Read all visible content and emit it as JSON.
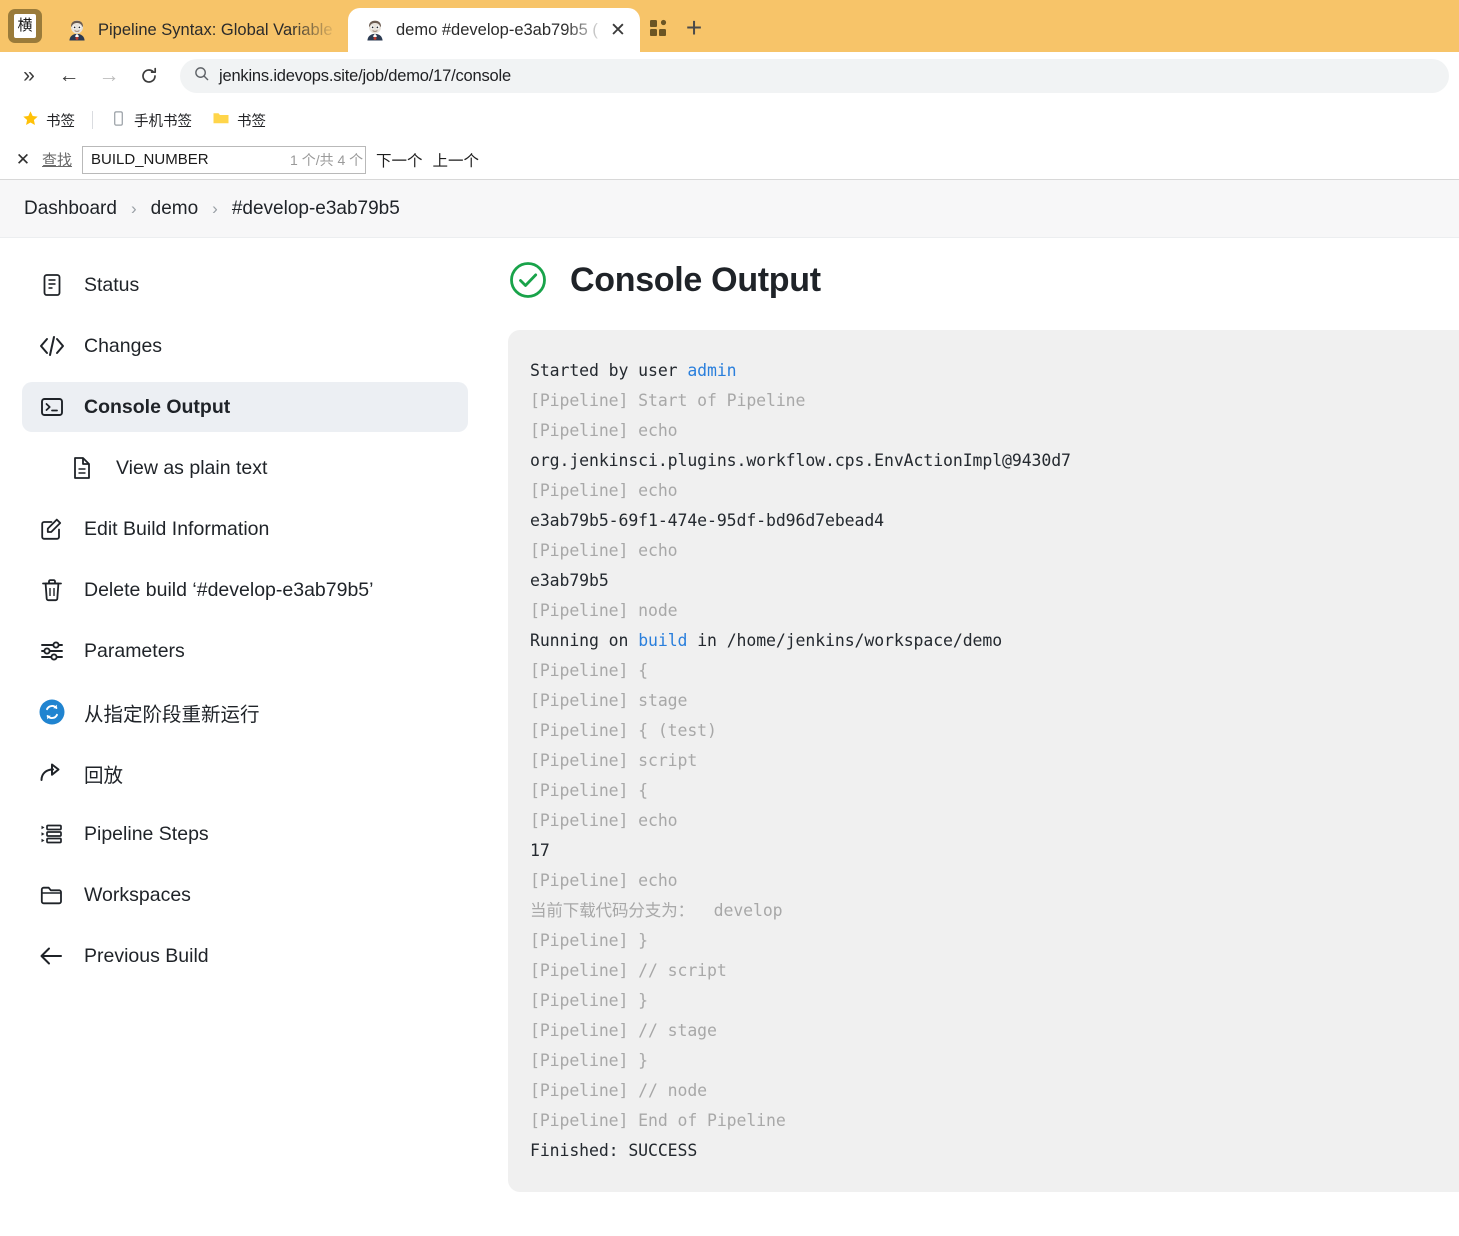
{
  "browser": {
    "app_badge_label": "横",
    "tabs": [
      {
        "title": "Pipeline Syntax: Global Variable",
        "favicon": "jenkins-butler-icon",
        "active": false
      },
      {
        "title": "demo #develop-e3ab79b5 (",
        "favicon": "jenkins-butler-icon",
        "active": true
      }
    ],
    "tab_close_label": "✕",
    "extensions_icon": "extensions-icon",
    "new_tab_label": "+",
    "toolbar": {
      "overflow_label": "»",
      "back_label": "←",
      "forward_label": "→",
      "reload_label": "⟳",
      "search_icon": "search-icon",
      "url": "jenkins.idevops.site/job/demo/17/console"
    },
    "bookmarks": [
      {
        "icon": "star-icon",
        "label": "书签"
      },
      {
        "icon": "phone-icon",
        "label": "手机书签"
      },
      {
        "icon": "folder-icon",
        "label": "书签"
      }
    ],
    "findbar": {
      "close_label": "✕",
      "label": "查找",
      "value": "BUILD_NUMBER",
      "placeholder": "",
      "count": "1 个/共 4 个",
      "next_label": "下一个",
      "prev_label": "上一个"
    }
  },
  "breadcrumb": {
    "items": [
      "Dashboard",
      "demo",
      "#develop-e3ab79b5"
    ],
    "separator": "›"
  },
  "sidebar": {
    "items": [
      {
        "label": "Status",
        "icon": "document-icon",
        "active": false,
        "sub": false
      },
      {
        "label": "Changes",
        "icon": "code-icon",
        "active": false,
        "sub": false
      },
      {
        "label": "Console Output",
        "icon": "terminal-icon",
        "active": true,
        "sub": false
      },
      {
        "label": "View as plain text",
        "icon": "file-text-icon",
        "active": false,
        "sub": true
      },
      {
        "label": "Edit Build Information",
        "icon": "edit-icon",
        "active": false,
        "sub": false
      },
      {
        "label": "Delete build ‘#develop-e3ab79b5’",
        "icon": "trash-icon",
        "active": false,
        "sub": false
      },
      {
        "label": "Parameters",
        "icon": "sliders-icon",
        "active": false,
        "sub": false
      },
      {
        "label": "从指定阶段重新运行",
        "icon": "restart-blue-icon",
        "active": false,
        "sub": false
      },
      {
        "label": "回放",
        "icon": "replay-arrow-icon",
        "active": false,
        "sub": false
      },
      {
        "label": "Pipeline Steps",
        "icon": "steps-list-icon",
        "active": false,
        "sub": false
      },
      {
        "label": "Workspaces",
        "icon": "folder-open-icon",
        "active": false,
        "sub": false
      },
      {
        "label": "Previous Build",
        "icon": "arrow-left-icon",
        "active": false,
        "sub": false
      }
    ]
  },
  "main": {
    "status_icon": "success-check-circle-icon",
    "status_color": "#19a34a",
    "title": "Console Output",
    "console_lines": [
      {
        "segments": [
          {
            "text": "Started by user ",
            "style": "normal"
          },
          {
            "text": "admin",
            "style": "link"
          }
        ]
      },
      {
        "segments": [
          {
            "text": "[Pipeline] Start of Pipeline",
            "style": "dim"
          }
        ]
      },
      {
        "segments": [
          {
            "text": "[Pipeline] echo",
            "style": "dim"
          }
        ]
      },
      {
        "segments": [
          {
            "text": "org.jenkinsci.plugins.workflow.cps.EnvActionImpl@9430d7",
            "style": "normal"
          }
        ]
      },
      {
        "segments": [
          {
            "text": "[Pipeline] echo",
            "style": "dim"
          }
        ]
      },
      {
        "segments": [
          {
            "text": "e3ab79b5-69f1-474e-95df-bd96d7ebead4",
            "style": "normal"
          }
        ]
      },
      {
        "segments": [
          {
            "text": "[Pipeline] echo",
            "style": "dim"
          }
        ]
      },
      {
        "segments": [
          {
            "text": "e3ab79b5",
            "style": "normal"
          }
        ]
      },
      {
        "segments": [
          {
            "text": "[Pipeline] node",
            "style": "dim"
          }
        ]
      },
      {
        "segments": [
          {
            "text": "Running on ",
            "style": "normal"
          },
          {
            "text": "build",
            "style": "link"
          },
          {
            "text": " in /home/jenkins/workspace/demo",
            "style": "normal"
          }
        ]
      },
      {
        "segments": [
          {
            "text": "[Pipeline] {",
            "style": "dim"
          }
        ]
      },
      {
        "segments": [
          {
            "text": "[Pipeline] stage",
            "style": "dim"
          }
        ]
      },
      {
        "segments": [
          {
            "text": "[Pipeline] { (test)",
            "style": "dim"
          }
        ]
      },
      {
        "segments": [
          {
            "text": "[Pipeline] script",
            "style": "dim"
          }
        ]
      },
      {
        "segments": [
          {
            "text": "[Pipeline] {",
            "style": "dim"
          }
        ]
      },
      {
        "segments": [
          {
            "text": "[Pipeline] echo",
            "style": "dim"
          }
        ]
      },
      {
        "segments": [
          {
            "text": "17",
            "style": "normal"
          }
        ]
      },
      {
        "segments": [
          {
            "text": "[Pipeline] echo",
            "style": "dim"
          }
        ]
      },
      {
        "segments": [
          {
            "text": "当前下载代码分支为：  develop",
            "style": "dim"
          }
        ]
      },
      {
        "segments": [
          {
            "text": "[Pipeline] }",
            "style": "dim"
          }
        ]
      },
      {
        "segments": [
          {
            "text": "[Pipeline] // script",
            "style": "dim"
          }
        ]
      },
      {
        "segments": [
          {
            "text": "[Pipeline] }",
            "style": "dim"
          }
        ]
      },
      {
        "segments": [
          {
            "text": "[Pipeline] // stage",
            "style": "dim"
          }
        ]
      },
      {
        "segments": [
          {
            "text": "[Pipeline] }",
            "style": "dim"
          }
        ]
      },
      {
        "segments": [
          {
            "text": "[Pipeline] // node",
            "style": "dim"
          }
        ]
      },
      {
        "segments": [
          {
            "text": "[Pipeline] End of Pipeline",
            "style": "dim"
          }
        ]
      },
      {
        "segments": [
          {
            "text": "Finished: SUCCESS",
            "style": "normal"
          }
        ]
      }
    ]
  },
  "colors": {
    "tabstrip": "#f7c469",
    "link": "#2a7fdc",
    "console_bg": "#f0f0f0",
    "dim_text": "#a8a8a8"
  }
}
